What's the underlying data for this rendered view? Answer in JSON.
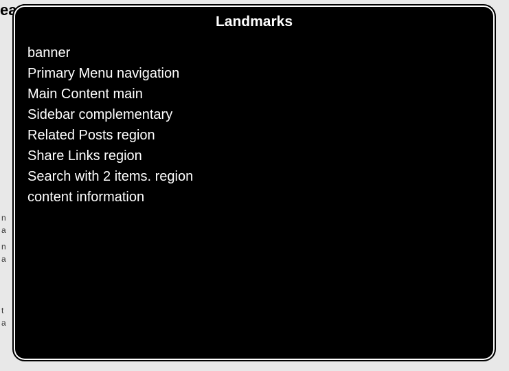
{
  "panel": {
    "title": "Landmarks",
    "items": [
      "banner",
      "Primary Menu navigation",
      "Main Content main",
      "Sidebar complementary",
      "Related Posts region",
      "Share Links region",
      "Search with 2 items. region",
      "content information"
    ]
  },
  "background": {
    "heading_fragment": "ead",
    "fragments": [
      "n",
      "a",
      "n",
      "a",
      "t",
      "a"
    ]
  }
}
